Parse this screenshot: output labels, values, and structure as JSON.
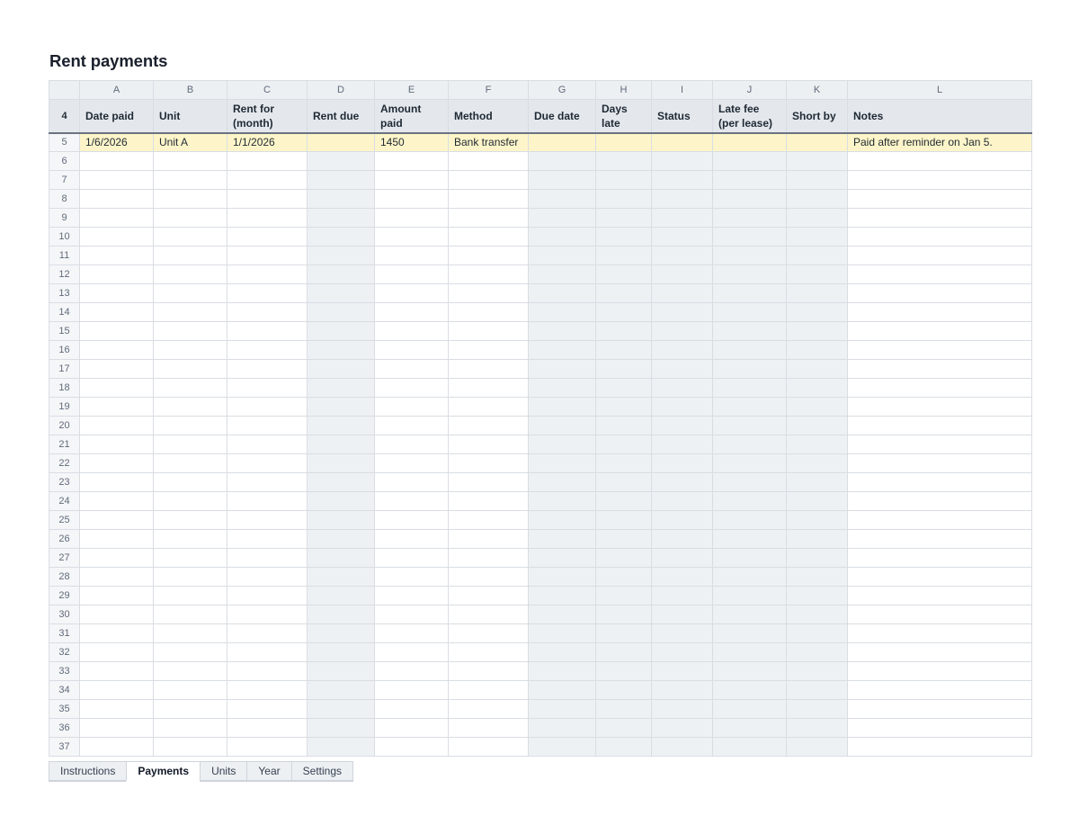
{
  "title": "Rent payments",
  "column_letters": [
    "A",
    "B",
    "C",
    "D",
    "E",
    "F",
    "G",
    "H",
    "I",
    "J",
    "K",
    "L"
  ],
  "header_row": {
    "row_number": "4",
    "labels": [
      "Date paid",
      "Unit",
      "Rent for (month)",
      "Rent due",
      "Amount paid",
      "Method",
      "Due date",
      "Days late",
      "Status",
      "Late fee (per lease)",
      "Short by",
      "Notes"
    ]
  },
  "rows": [
    {
      "n": "5",
      "cells": [
        "1/6/2026",
        "Unit A",
        "1/1/2026",
        "",
        "1450",
        "Bank transfer",
        "",
        "",
        "",
        "",
        "",
        "Paid after reminder on Jan 5."
      ]
    },
    {
      "n": "6",
      "cells": [
        "",
        "",
        "",
        "",
        "",
        "",
        "",
        "",
        "",
        "",
        "",
        ""
      ]
    },
    {
      "n": "7",
      "cells": [
        "",
        "",
        "",
        "",
        "",
        "",
        "",
        "",
        "",
        "",
        "",
        ""
      ]
    },
    {
      "n": "8",
      "cells": [
        "",
        "",
        "",
        "",
        "",
        "",
        "",
        "",
        "",
        "",
        "",
        ""
      ]
    },
    {
      "n": "9",
      "cells": [
        "",
        "",
        "",
        "",
        "",
        "",
        "",
        "",
        "",
        "",
        "",
        ""
      ]
    },
    {
      "n": "10",
      "cells": [
        "",
        "",
        "",
        "",
        "",
        "",
        "",
        "",
        "",
        "",
        "",
        ""
      ]
    },
    {
      "n": "11",
      "cells": [
        "",
        "",
        "",
        "",
        "",
        "",
        "",
        "",
        "",
        "",
        "",
        ""
      ]
    },
    {
      "n": "12",
      "cells": [
        "",
        "",
        "",
        "",
        "",
        "",
        "",
        "",
        "",
        "",
        "",
        ""
      ]
    },
    {
      "n": "13",
      "cells": [
        "",
        "",
        "",
        "",
        "",
        "",
        "",
        "",
        "",
        "",
        "",
        ""
      ]
    },
    {
      "n": "14",
      "cells": [
        "",
        "",
        "",
        "",
        "",
        "",
        "",
        "",
        "",
        "",
        "",
        ""
      ]
    },
    {
      "n": "15",
      "cells": [
        "",
        "",
        "",
        "",
        "",
        "",
        "",
        "",
        "",
        "",
        "",
        ""
      ]
    },
    {
      "n": "16",
      "cells": [
        "",
        "",
        "",
        "",
        "",
        "",
        "",
        "",
        "",
        "",
        "",
        ""
      ]
    },
    {
      "n": "17",
      "cells": [
        "",
        "",
        "",
        "",
        "",
        "",
        "",
        "",
        "",
        "",
        "",
        ""
      ]
    },
    {
      "n": "18",
      "cells": [
        "",
        "",
        "",
        "",
        "",
        "",
        "",
        "",
        "",
        "",
        "",
        ""
      ]
    },
    {
      "n": "19",
      "cells": [
        "",
        "",
        "",
        "",
        "",
        "",
        "",
        "",
        "",
        "",
        "",
        ""
      ]
    },
    {
      "n": "20",
      "cells": [
        "",
        "",
        "",
        "",
        "",
        "",
        "",
        "",
        "",
        "",
        "",
        ""
      ]
    },
    {
      "n": "21",
      "cells": [
        "",
        "",
        "",
        "",
        "",
        "",
        "",
        "",
        "",
        "",
        "",
        ""
      ]
    },
    {
      "n": "22",
      "cells": [
        "",
        "",
        "",
        "",
        "",
        "",
        "",
        "",
        "",
        "",
        "",
        ""
      ]
    },
    {
      "n": "23",
      "cells": [
        "",
        "",
        "",
        "",
        "",
        "",
        "",
        "",
        "",
        "",
        "",
        ""
      ]
    },
    {
      "n": "24",
      "cells": [
        "",
        "",
        "",
        "",
        "",
        "",
        "",
        "",
        "",
        "",
        "",
        ""
      ]
    },
    {
      "n": "25",
      "cells": [
        "",
        "",
        "",
        "",
        "",
        "",
        "",
        "",
        "",
        "",
        "",
        ""
      ]
    },
    {
      "n": "26",
      "cells": [
        "",
        "",
        "",
        "",
        "",
        "",
        "",
        "",
        "",
        "",
        "",
        ""
      ]
    },
    {
      "n": "27",
      "cells": [
        "",
        "",
        "",
        "",
        "",
        "",
        "",
        "",
        "",
        "",
        "",
        ""
      ]
    },
    {
      "n": "28",
      "cells": [
        "",
        "",
        "",
        "",
        "",
        "",
        "",
        "",
        "",
        "",
        "",
        ""
      ]
    },
    {
      "n": "29",
      "cells": [
        "",
        "",
        "",
        "",
        "",
        "",
        "",
        "",
        "",
        "",
        "",
        ""
      ]
    },
    {
      "n": "30",
      "cells": [
        "",
        "",
        "",
        "",
        "",
        "",
        "",
        "",
        "",
        "",
        "",
        ""
      ]
    },
    {
      "n": "31",
      "cells": [
        "",
        "",
        "",
        "",
        "",
        "",
        "",
        "",
        "",
        "",
        "",
        ""
      ]
    },
    {
      "n": "32",
      "cells": [
        "",
        "",
        "",
        "",
        "",
        "",
        "",
        "",
        "",
        "",
        "",
        ""
      ]
    },
    {
      "n": "33",
      "cells": [
        "",
        "",
        "",
        "",
        "",
        "",
        "",
        "",
        "",
        "",
        "",
        ""
      ]
    },
    {
      "n": "34",
      "cells": [
        "",
        "",
        "",
        "",
        "",
        "",
        "",
        "",
        "",
        "",
        "",
        ""
      ]
    },
    {
      "n": "35",
      "cells": [
        "",
        "",
        "",
        "",
        "",
        "",
        "",
        "",
        "",
        "",
        "",
        ""
      ]
    },
    {
      "n": "36",
      "cells": [
        "",
        "",
        "",
        "",
        "",
        "",
        "",
        "",
        "",
        "",
        "",
        ""
      ]
    },
    {
      "n": "37",
      "cells": [
        "",
        "",
        "",
        "",
        "",
        "",
        "",
        "",
        "",
        "",
        "",
        ""
      ]
    }
  ],
  "highlighted_row": "5",
  "sheet_tabs": [
    {
      "label": "Instructions",
      "active": false
    },
    {
      "label": "Payments",
      "active": true
    },
    {
      "label": "Units",
      "active": false
    },
    {
      "label": "Year",
      "active": false
    },
    {
      "label": "Settings",
      "active": false
    }
  ],
  "colors": {
    "highlight_row": "#fdf5c9",
    "calculated_column": "#eef1f4",
    "header": "#e4e8ed"
  }
}
